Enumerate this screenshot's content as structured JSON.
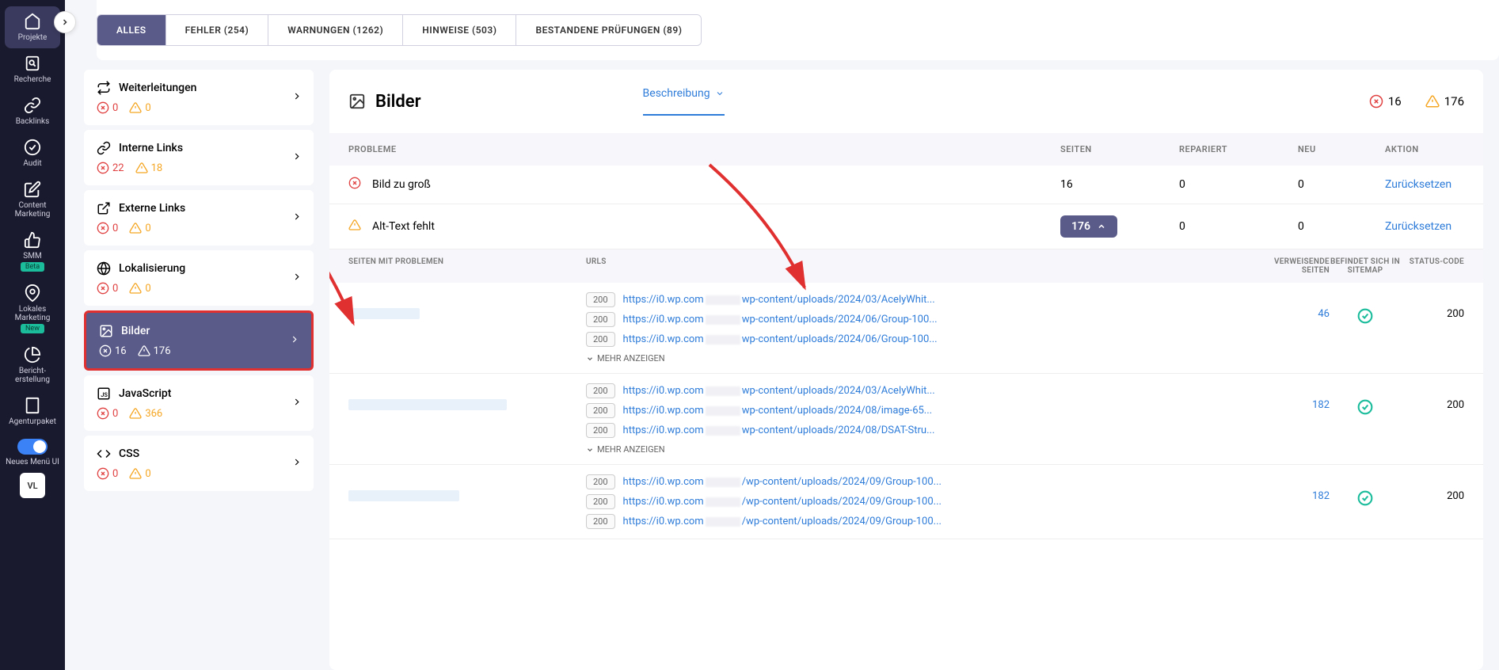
{
  "nav": {
    "items": [
      {
        "label": "Projekte",
        "icon": "home"
      },
      {
        "label": "Recherche",
        "icon": "search-doc"
      },
      {
        "label": "Backlinks",
        "icon": "link"
      },
      {
        "label": "Audit",
        "icon": "check-circle"
      },
      {
        "label": "Content Marketing",
        "icon": "edit"
      },
      {
        "label": "SMM",
        "icon": "thumbs-up",
        "badge": "Beta"
      },
      {
        "label": "Lokales Marketing",
        "icon": "pin",
        "badge": "New"
      },
      {
        "label": "Bericht-erstellung",
        "icon": "pie"
      },
      {
        "label": "Agenturpaket",
        "icon": "building"
      }
    ],
    "toggle_label": "Neues Menü UI",
    "avatar": "VL"
  },
  "tabs": [
    {
      "label": "ALLES",
      "active": true
    },
    {
      "label": "FEHLER (254)"
    },
    {
      "label": "WARNUNGEN (1262)"
    },
    {
      "label": "HINWEISE (503)"
    },
    {
      "label": "BESTANDENE PRÜFUNGEN (89)"
    }
  ],
  "categories": [
    {
      "title": "Weiterleitungen",
      "icon": "redirect",
      "err": 0,
      "warn": 0
    },
    {
      "title": "Interne Links",
      "icon": "link",
      "err": 22,
      "warn": 18
    },
    {
      "title": "Externe Links",
      "icon": "ext-link",
      "err": 0,
      "warn": 0
    },
    {
      "title": "Lokalisierung",
      "icon": "globe",
      "err": 0,
      "warn": 0
    },
    {
      "title": "Bilder",
      "icon": "image",
      "err": 16,
      "warn": 176,
      "active": true
    },
    {
      "title": "JavaScript",
      "icon": "js",
      "err": 0,
      "warn": 366
    },
    {
      "title": "CSS",
      "icon": "code",
      "err": 0,
      "warn": 0
    }
  ],
  "detail": {
    "title": "Bilder",
    "description_label": "Beschreibung",
    "header_err": 16,
    "header_warn": 176,
    "columns": {
      "problems": "PROBLEME",
      "pages": "SEITEN",
      "repaired": "REPARIERT",
      "new": "NEU",
      "action": "AKTION"
    },
    "problems": [
      {
        "type": "err",
        "label": "Bild zu groß",
        "pages": 16,
        "repaired": 0,
        "new": 0,
        "action": "Zurücksetzen"
      },
      {
        "type": "warn",
        "label": "Alt-Text fehlt",
        "pages": 176,
        "repaired": 0,
        "new": 0,
        "action": "Zurücksetzen",
        "expanded": true
      }
    ],
    "sub_columns": {
      "page": "SEITEN MIT PROBLEMEN",
      "urls": "URLS",
      "ref": "VERWEISENDE SEITEN",
      "sitemap": "BEFINDET SICH IN SITEMAP",
      "status": "STATUS-CODE"
    },
    "more_label": "MEHR ANZEIGEN",
    "rows": [
      {
        "urls": [
          {
            "code": 200,
            "pre": "https://i0.wp.com",
            "post": "wp-content/uploads/2024/03/AcelyWhit..."
          },
          {
            "code": 200,
            "pre": "https://i0.wp.com",
            "post": "wp-content/uploads/2024/06/Group-100..."
          },
          {
            "code": 200,
            "pre": "https://i0.wp.com",
            "post": "wp-content/uploads/2024/06/Group-100..."
          }
        ],
        "ref": 46,
        "sitemap": true,
        "status": 200
      },
      {
        "urls": [
          {
            "code": 200,
            "pre": "https://i0.wp.com",
            "post": "wp-content/uploads/2024/03/AcelyWhit..."
          },
          {
            "code": 200,
            "pre": "https://i0.wp.com",
            "post": "wp-content/uploads/2024/08/image-65..."
          },
          {
            "code": 200,
            "pre": "https://i0.wp.com",
            "post": "wp-content/uploads/2024/08/DSAT-Stru..."
          }
        ],
        "ref": 182,
        "sitemap": true,
        "status": 200
      },
      {
        "urls": [
          {
            "code": 200,
            "pre": "https://i0.wp.com",
            "post": "/wp-content/uploads/2024/09/Group-100..."
          },
          {
            "code": 200,
            "pre": "https://i0.wp.com",
            "post": "/wp-content/uploads/2024/09/Group-100..."
          },
          {
            "code": 200,
            "pre": "https://i0.wp.com",
            "post": "/wp-content/uploads/2024/09/Group-100..."
          }
        ],
        "ref": 182,
        "sitemap": true,
        "status": 200
      }
    ]
  }
}
